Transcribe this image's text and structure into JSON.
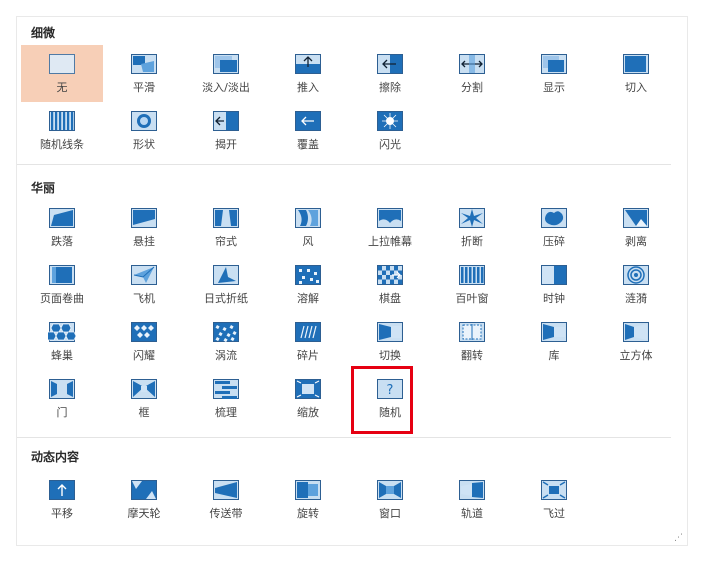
{
  "sections": [
    {
      "title": "细微",
      "items": [
        {
          "label": "无",
          "icon": "none-icon",
          "selected": true
        },
        {
          "label": "平滑",
          "icon": "morph-icon"
        },
        {
          "label": "淡入/淡出",
          "icon": "fade-icon"
        },
        {
          "label": "推入",
          "icon": "push-icon"
        },
        {
          "label": "擦除",
          "icon": "wipe-icon"
        },
        {
          "label": "分割",
          "icon": "split-icon"
        },
        {
          "label": "显示",
          "icon": "reveal-icon"
        },
        {
          "label": "切入",
          "icon": "cut-icon"
        },
        {
          "label": "随机线条",
          "icon": "random-bars-icon"
        },
        {
          "label": "形状",
          "icon": "shape-icon"
        },
        {
          "label": "揭开",
          "icon": "uncover-icon"
        },
        {
          "label": "覆盖",
          "icon": "cover-icon"
        },
        {
          "label": "闪光",
          "icon": "flash-icon"
        }
      ]
    },
    {
      "title": "华丽",
      "items": [
        {
          "label": "跌落",
          "icon": "fall-over-icon"
        },
        {
          "label": "悬挂",
          "icon": "drape-icon"
        },
        {
          "label": "帘式",
          "icon": "curtains-icon"
        },
        {
          "label": "风",
          "icon": "wind-icon"
        },
        {
          "label": "上拉帷幕",
          "icon": "prestige-icon"
        },
        {
          "label": "折断",
          "icon": "fracture-icon"
        },
        {
          "label": "压碎",
          "icon": "crush-icon"
        },
        {
          "label": "剥离",
          "icon": "peel-off-icon"
        },
        {
          "label": "页面卷曲",
          "icon": "page-curl-icon"
        },
        {
          "label": "飞机",
          "icon": "airplane-icon"
        },
        {
          "label": "日式折纸",
          "icon": "origami-icon"
        },
        {
          "label": "溶解",
          "icon": "dissolve-icon"
        },
        {
          "label": "棋盘",
          "icon": "checkerboard-icon"
        },
        {
          "label": "百叶窗",
          "icon": "blinds-icon"
        },
        {
          "label": "时钟",
          "icon": "clock-icon"
        },
        {
          "label": "涟漪",
          "icon": "ripple-icon"
        },
        {
          "label": "蜂巢",
          "icon": "honeycomb-icon"
        },
        {
          "label": "闪耀",
          "icon": "glitter-icon"
        },
        {
          "label": "涡流",
          "icon": "vortex-icon"
        },
        {
          "label": "碎片",
          "icon": "shred-icon"
        },
        {
          "label": "切换",
          "icon": "switch-icon"
        },
        {
          "label": "翻转",
          "icon": "flip-icon"
        },
        {
          "label": "库",
          "icon": "gallery-icon"
        },
        {
          "label": "立方体",
          "icon": "cube-icon"
        },
        {
          "label": "门",
          "icon": "doors-icon"
        },
        {
          "label": "框",
          "icon": "box-icon"
        },
        {
          "label": "梳理",
          "icon": "comb-icon"
        },
        {
          "label": "缩放",
          "icon": "zoom-icon"
        },
        {
          "label": "随机",
          "icon": "random-icon"
        }
      ]
    },
    {
      "title": "动态内容",
      "items": [
        {
          "label": "平移",
          "icon": "pan-icon"
        },
        {
          "label": "摩天轮",
          "icon": "ferris-wheel-icon"
        },
        {
          "label": "传送带",
          "icon": "conveyor-icon"
        },
        {
          "label": "旋转",
          "icon": "rotate-icon"
        },
        {
          "label": "窗口",
          "icon": "window-icon"
        },
        {
          "label": "轨道",
          "icon": "orbit-icon"
        },
        {
          "label": "飞过",
          "icon": "fly-through-icon"
        }
      ]
    }
  ],
  "colors": {
    "selected_bg": "#f7cfb7",
    "icon_blue": "#1f6fb8",
    "highlight": "#e60012"
  }
}
